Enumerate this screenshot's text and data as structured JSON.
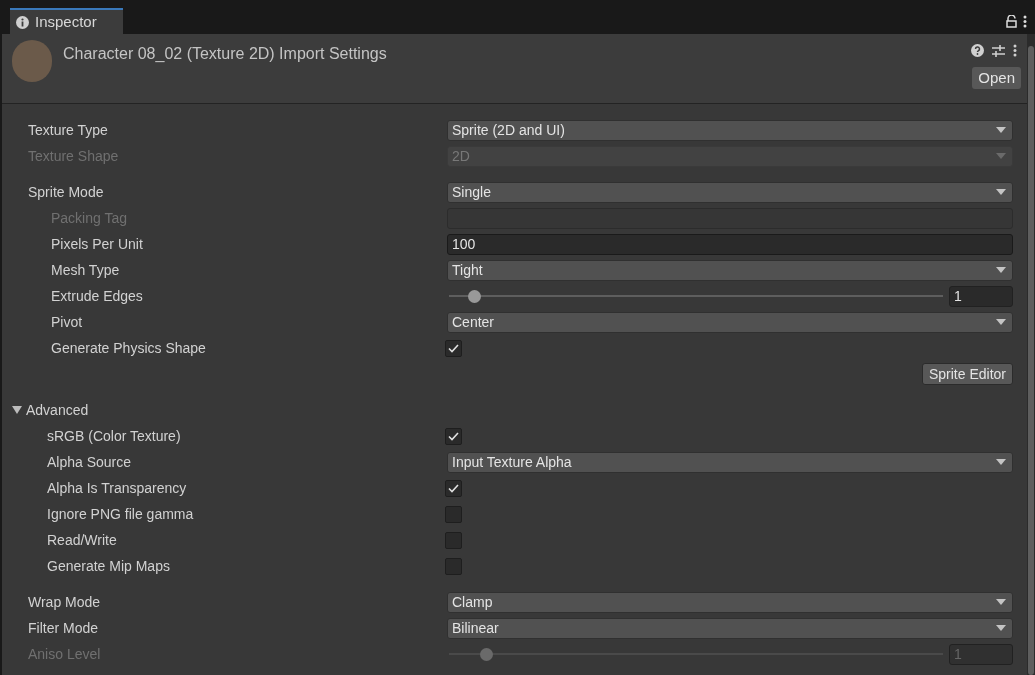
{
  "tab": {
    "label": "Inspector",
    "selected": true
  },
  "header": {
    "title": "Character 08_02 (Texture 2D) Import Settings",
    "open_button": "Open"
  },
  "groups": [
    {
      "rows": [
        {
          "kind": "dropdown",
          "label": "Texture Type",
          "value": "Sprite (2D and UI)",
          "disabled": false
        },
        {
          "kind": "dropdown",
          "label": "Texture Shape",
          "value": "2D",
          "disabled": true
        }
      ]
    },
    {
      "rows": [
        {
          "kind": "dropdown",
          "label": "Sprite Mode",
          "value": "Single",
          "disabled": false,
          "children": [
            {
              "kind": "text",
              "label": "Packing Tag",
              "disabled": true
            },
            {
              "kind": "text",
              "label": "Pixels Per Unit",
              "value": "100",
              "disabled": false
            },
            {
              "kind": "dropdown",
              "label": "Mesh Type",
              "value": "Tight",
              "disabled": false
            },
            {
              "kind": "slider",
              "label": "Extrude Edges",
              "value": "1",
              "level": 0.05,
              "disabled": false
            },
            {
              "kind": "dropdown",
              "label": "Pivot",
              "value": "Center",
              "disabled": false
            },
            {
              "kind": "checkbox",
              "label": "Generate Physics Shape",
              "checked": true
            },
            {
              "kind": "button",
              "value": "Sprite Editor",
              "disabled": false
            }
          ]
        }
      ]
    },
    {
      "rows": [
        {
          "kind": "foldout",
          "label": "Advanced",
          "expanded": true,
          "children": [
            {
              "kind": "checkbox",
              "label": "sRGB (Color Texture)",
              "checked": true
            },
            {
              "kind": "dropdown",
              "label": "Alpha Source",
              "value": "Input Texture Alpha",
              "disabled": false
            },
            {
              "kind": "checkbox",
              "label": "Alpha Is Transparency",
              "checked": true
            },
            {
              "kind": "checkbox",
              "label": "Ignore PNG file gamma",
              "checked": false
            },
            {
              "kind": "checkbox",
              "label": "Read/Write",
              "checked": false
            },
            {
              "kind": "checkbox",
              "label": "Generate Mip Maps",
              "checked": false
            }
          ]
        }
      ]
    },
    {
      "rows": [
        {
          "kind": "dropdown",
          "label": "Wrap Mode",
          "value": "Clamp",
          "disabled": false
        },
        {
          "kind": "dropdown",
          "label": "Filter Mode",
          "value": "Bilinear",
          "disabled": false
        },
        {
          "kind": "slider",
          "label": "Aniso Level",
          "value": "1",
          "level": 0.075,
          "disabled": true
        }
      ]
    }
  ]
}
